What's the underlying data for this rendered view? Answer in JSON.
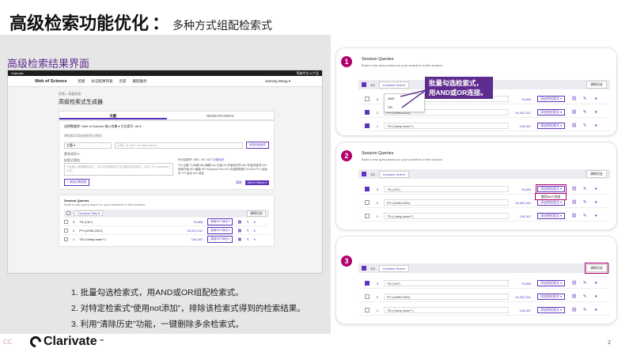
{
  "slide": {
    "title_main": "高级检索功能优化",
    "title_colon": "：",
    "title_sub": "多种方式组配检索式",
    "left_heading": "高级检索结果界面",
    "steps": [
      "1. 批量勾选检索式，用AND或OR组配检索式。",
      "2. 对特定检索式“使用not添加”，排除该检索式得到的检索结果。",
      "3. 利用“清除历史”功能，一键删除多余检索式。"
    ],
    "logo_text": "Clarivate",
    "logo_tm": "™",
    "page_number": "2",
    "corner_tag": "CC"
  },
  "wos": {
    "brand": "Clarivate",
    "top_right": "简体中文 ▾  产品",
    "logo": "Web of Science",
    "nav": [
      "检索",
      "标记结果列表",
      "历史",
      "跟踪服务"
    ],
    "user": "Jiaming Wang ▾",
    "crumb": "检索 > 高级检索",
    "page_title": "高级检索式生成器",
    "tabs": [
      "文献",
      "RESEARCHERS"
    ],
    "db_line": "选择数据库: Web of Science 核心合集 ▾   引文索引: All ▾",
    "add_terms": "将检索词添加到检索式预览",
    "field": "主题 ▾",
    "field_placeholder": "示例: oil spill* mediterranean",
    "add_btn": "添加到检索式",
    "more": "更多选项 ▾",
    "preview_label": "检索式预览",
    "preview_placeholder": "在此输入或编辑检索式。也可以使用检索式生成器添加检索式。示例: TS=(nanotube*) AND...",
    "booleans": "布尔运算符: AND, OR, NOT",
    "field_tags": "字段标识",
    "tag_examples": "TS=主题  TI=标题  AB=摘要  AU=作者  AI=作者标识符  AK=作者关键词  GP=团体作者  ED=编者  KP=Keyword Plus  SO=出版物标题  DO=DOI  PY=出版年  CF=会议  AD=地址",
    "clear_btn": "清除",
    "search_btn": "检索",
    "add_date": "+ 添加日期范围",
    "history_btn": "Add to history ▾",
    "session_title": "Session Queries",
    "session_sub": "Build a new query based on your searches in this session.",
    "combine": "Combine Sets ▾",
    "clear_history": "清除历史",
    "rows": [
      {
        "num": "3",
        "text": "TS=(\"AI\")",
        "count": "76,665"
      },
      {
        "num": "2",
        "text": "PY=(1990-2021)",
        "count": "94,020,311"
      },
      {
        "num": "1",
        "text": "TS=(\"deep learn*\")",
        "count": "106,397"
      }
    ],
    "add_not": "使用NOT添加 ▾"
  },
  "panels": [
    {
      "step": "1",
      "title": "Session Queries",
      "subtitle": "Build a new query based on your searches in this session.",
      "selected": "1/3",
      "combine": "Combine Sets ▾",
      "clear": "清除历史",
      "dropdown": [
        "AND",
        "OR"
      ],
      "rows": [
        {
          "num": "3",
          "text": "",
          "count": "76,665",
          "checked": false
        },
        {
          "num": "2",
          "text": "PY=(1990-2021)",
          "count": "94,020,311",
          "checked": true
        },
        {
          "num": "1",
          "text": "TS=(\"deep learn*\")",
          "count": "106,397",
          "checked": true
        }
      ]
    },
    {
      "step": "2",
      "title": "Session Queries",
      "subtitle": "Build a new query based on your searches in this session.",
      "selected": "1/3",
      "combine": "Combine Sets ▾",
      "clear": "清除历史",
      "popup": "使用NOT添加",
      "rows": [
        {
          "num": "3",
          "text": "TS=(\"AI\")",
          "count": "76,665",
          "checked": true
        },
        {
          "num": "2",
          "text": "PY=(1990-2021)",
          "count": "94,020,311",
          "checked": false
        },
        {
          "num": "1",
          "text": "TS=(\"deep learn*\")",
          "count": "106,397",
          "checked": false
        }
      ]
    },
    {
      "step": "3",
      "title": "Session Queries",
      "subtitle": "Build a new query based on your searches in this session.",
      "selected": "1/3",
      "combine": "Combine Sets ▾",
      "clear": "清除历史",
      "rows": [
        {
          "num": "3",
          "text": "TS=(\"AI\")",
          "count": "76,665",
          "checked": true
        },
        {
          "num": "2",
          "text": "PY=(1990-2021)",
          "count": "94,020,311",
          "checked": false
        },
        {
          "num": "1",
          "text": "TS=(\"deep learn*\")",
          "count": "106,397",
          "checked": false
        }
      ]
    }
  ],
  "row_button": "添加到检索式 ▾",
  "row_icons": [
    "link-icon",
    "pencil-icon",
    "bell-icon"
  ],
  "callout": {
    "line1": "批量勾选检索式，",
    "line2": "用AND或OR连接。"
  },
  "colors": {
    "brand_purple": "#5e33bf",
    "badge_magenta": "#b0006b",
    "callout_bg": "#5e2b8e",
    "heading_purple": "#5b2d8e"
  }
}
